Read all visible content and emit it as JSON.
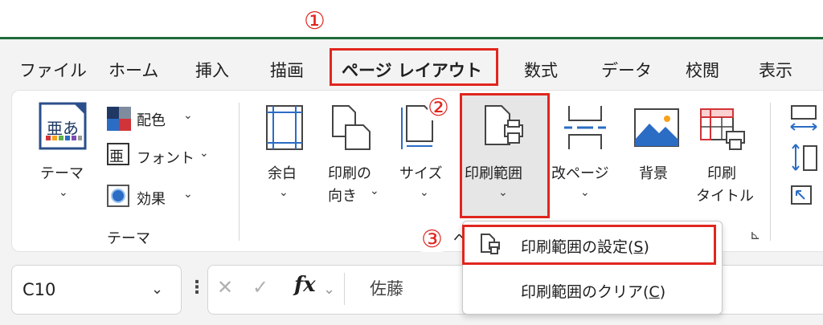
{
  "annotations": {
    "step1": "①",
    "step2": "②",
    "step3": "③"
  },
  "tabs": [
    "ファイル",
    "ホーム",
    "挿入",
    "描画",
    "ページ レイアウト",
    "数式",
    "データ",
    "校閲",
    "表示"
  ],
  "ribbon": {
    "themes": {
      "theme_label": "テーマ",
      "colors_label": "配色",
      "fonts_label": "フォント",
      "effects_label": "効果",
      "group_label": "テーマ",
      "theme_icon_text": "亜あ",
      "font_icon_text": "亜"
    },
    "page_setup": {
      "margins_label": "余白",
      "orientation_label_1": "印刷の",
      "orientation_label_2": "向き",
      "size_label": "サイズ",
      "print_area_label": "印刷範囲",
      "breaks_label": "改ページ",
      "background_label": "背景",
      "print_titles_label_1": "印刷",
      "print_titles_label_2": "タイトル",
      "group_label_fragment": "ペ",
      "dialog_launcher": "⊾"
    }
  },
  "dropdown": {
    "items": [
      {
        "label": "印刷範囲の設定(S)",
        "label_main": "印刷範囲の設定(",
        "accel": "S",
        "label_end": ")"
      },
      {
        "label": "印刷範囲のクリア(C)",
        "label_main": "印刷範囲のクリア(",
        "accel": "C",
        "label_end": ")"
      }
    ]
  },
  "formula_bar": {
    "name_box": "C10",
    "function_symbol": "fx",
    "cell_value": "佐藤"
  },
  "colors": {
    "accent": "#e0261e",
    "excel_green": "#1e6b3a",
    "icon_blue": "#2b6cc4",
    "icon_red": "#d13438"
  }
}
